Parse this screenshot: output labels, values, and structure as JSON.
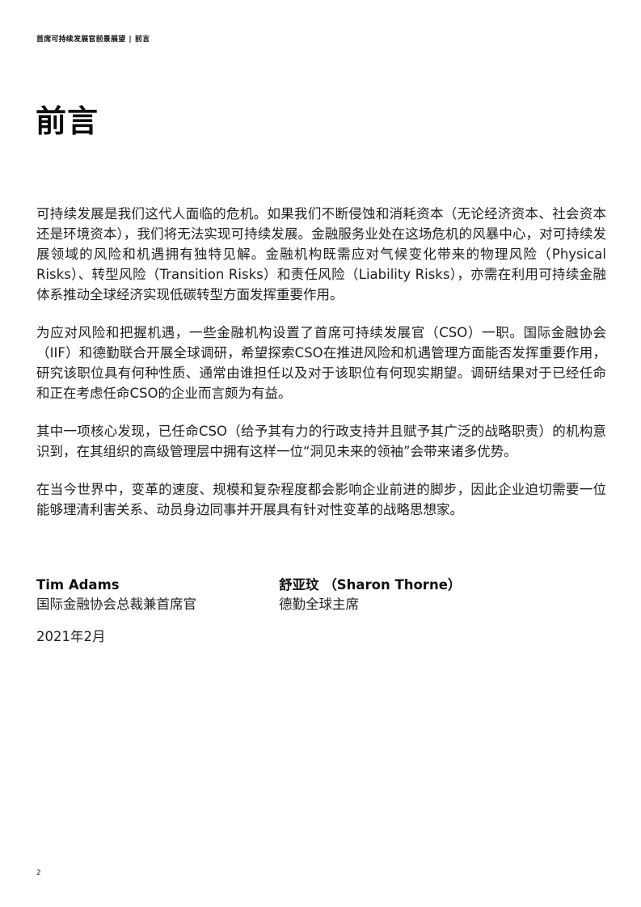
{
  "header": {
    "report_title": "首席可持续发展官前景展望",
    "separator": "|",
    "section": "前言"
  },
  "title": "前言",
  "paragraphs": [
    "可持续发展是我们这代人面临的危机。如果我们不断侵蚀和消耗资本（无论经济资本、社会资本还是环境资本），我们将无法实现可持续发展。金融服务业处在这场危机的风暴中心，对可持续发展领域的风险和机遇拥有独特见解。金融机构既需应对气候变化带来的物理风险（Physical Risks）、转型风险（Transition Risks）和责任风险（Liability Risks），亦需在利用可持续金融体系推动全球经济实现低碳转型方面发挥重要作用。",
    "为应对风险和把握机遇，一些金融机构设置了首席可持续发展官（CSO）一职。国际金融协会（IIF）和德勤联合开展全球调研，希望探索CSO在推进风险和机遇管理方面能否发挥重要作用，研究该职位具有何种性质、通常由谁担任以及对于该职位有何现实期望。调研结果对于已经任命和正在考虑任命CSO的企业而言颇为有益。",
    "其中一项核心发现，已任命CSO（给予其有力的行政支持并且赋予其广泛的战略职责）的机构意识到，在其组织的高级管理层中拥有这样一位“洞见未来的领袖”会带来诸多优势。",
    "在当今世界中，变革的速度、规模和复杂程度都会影响企业前进的脚步，因此企业迫切需要一位能够理清利害关系、动员身边同事并开展具有针对性变革的战略思想家。"
  ],
  "signatories": [
    {
      "name": "Tim Adams",
      "role": "国际金融协会总裁兼首席官"
    },
    {
      "name": "舒亚玟 （Sharon Thorne）",
      "role": "德勤全球主席"
    }
  ],
  "date": "2021年2月",
  "page_number": "2"
}
